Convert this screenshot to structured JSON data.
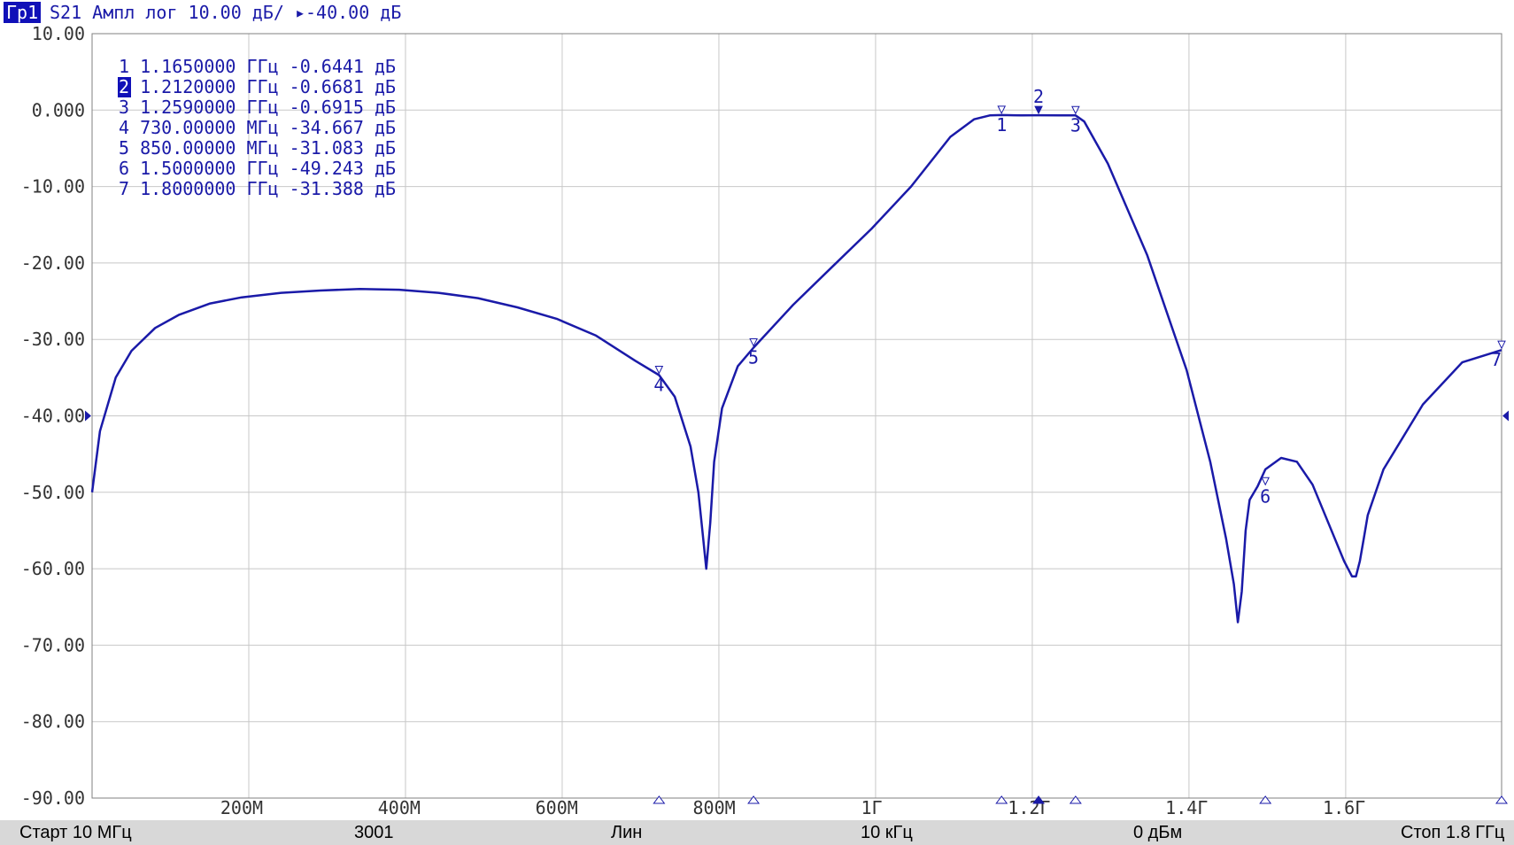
{
  "header": {
    "trace_tag": "Гр1",
    "trace_title": "S21 Ампл лог 10.00 дБ/ ▸-40.00 дБ"
  },
  "status": {
    "start": "Старт 10 МГц",
    "points": "3001",
    "sweep_type": "Лин",
    "ifbw": "10 кГц",
    "power": "0 дБм",
    "stop": "Стоп 1.8 ГГц"
  },
  "colors": {
    "trace": "#1a1aa8",
    "grid": "#c8c8c8",
    "active_marker_bg": "#1010b8"
  },
  "chart_data": {
    "type": "line",
    "title": "",
    "xlabel": "",
    "ylabel": "",
    "xlim": [
      0.01,
      1.8
    ],
    "ylim": [
      -90,
      10
    ],
    "reference_level": -40,
    "grid": true,
    "y_ticks": [
      {
        "value": 10,
        "label": "10.00"
      },
      {
        "value": 0,
        "label": "0.000"
      },
      {
        "value": -10,
        "label": "-10.00"
      },
      {
        "value": -20,
        "label": "-20.00"
      },
      {
        "value": -30,
        "label": "-30.00"
      },
      {
        "value": -40,
        "label": "-40.00"
      },
      {
        "value": -50,
        "label": "-50.00"
      },
      {
        "value": -60,
        "label": "-60.00"
      },
      {
        "value": -70,
        "label": "-70.00"
      },
      {
        "value": -80,
        "label": "-80.00"
      },
      {
        "value": -90,
        "label": "-90.00"
      }
    ],
    "x_ticks": [
      {
        "value": 0.2,
        "label": "200М"
      },
      {
        "value": 0.4,
        "label": "400М"
      },
      {
        "value": 0.6,
        "label": "600М"
      },
      {
        "value": 0.8,
        "label": "800М"
      },
      {
        "value": 1.0,
        "label": "1Г"
      },
      {
        "value": 1.2,
        "label": "1.2Г"
      },
      {
        "value": 1.4,
        "label": "1.4Г"
      },
      {
        "value": 1.6,
        "label": "1.6Г"
      }
    ],
    "x_grid": [
      0.01,
      0.209,
      0.408,
      0.607,
      0.806,
      1.005,
      1.204,
      1.403,
      1.602,
      1.8
    ],
    "series": [
      {
        "x": [
          0.01,
          0.02,
          0.04,
          0.06,
          0.09,
          0.12,
          0.16,
          0.2,
          0.25,
          0.3,
          0.35,
          0.4,
          0.45,
          0.5,
          0.55,
          0.6,
          0.65,
          0.7,
          0.73,
          0.75,
          0.77,
          0.78,
          0.785,
          0.79,
          0.795,
          0.8,
          0.81,
          0.83,
          0.85,
          0.9,
          0.95,
          1.0,
          1.05,
          1.1,
          1.13,
          1.15,
          1.165,
          1.19,
          1.212,
          1.24,
          1.259,
          1.27,
          1.3,
          1.35,
          1.4,
          1.43,
          1.45,
          1.46,
          1.465,
          1.47,
          1.475,
          1.48,
          1.49,
          1.5,
          1.52,
          1.54,
          1.56,
          1.58,
          1.6,
          1.61,
          1.615,
          1.62,
          1.625,
          1.63,
          1.65,
          1.7,
          1.75,
          1.8
        ],
        "y": [
          -50.0,
          -42.0,
          -35.0,
          -31.5,
          -28.5,
          -26.8,
          -25.3,
          -24.5,
          -23.9,
          -23.6,
          -23.4,
          -23.5,
          -23.9,
          -24.6,
          -25.8,
          -27.3,
          -29.5,
          -32.8,
          -34.667,
          -37.5,
          -44.0,
          -50.0,
          -55.0,
          -60.0,
          -54.0,
          -46.0,
          -39.0,
          -33.5,
          -31.083,
          -25.5,
          -20.5,
          -15.5,
          -10.0,
          -3.5,
          -1.2,
          -0.7,
          -0.6441,
          -0.7,
          -0.6681,
          -0.7,
          -0.6915,
          -1.5,
          -7.0,
          -19.0,
          -34.0,
          -46.0,
          -56.0,
          -62.0,
          -67.0,
          -63.0,
          -55.0,
          -51.0,
          -49.243,
          -47.0,
          -45.5,
          -46.0,
          -49.0,
          -54.0,
          -59.0,
          -61.0,
          -61.0,
          -59.0,
          -56.0,
          -53.0,
          -47.0,
          -38.5,
          -33.0,
          -31.388
        ]
      }
    ],
    "markers": [
      {
        "id": "1",
        "x": 1.165,
        "y": -0.6441,
        "readout": "1 1.1650000 ГГц -0.6441 дБ",
        "active": false,
        "label_side": "below"
      },
      {
        "id": "2",
        "x": 1.212,
        "y": -0.6681,
        "readout": "2 1.2120000 ГГц -0.6681 дБ",
        "active": true,
        "label_side": "above"
      },
      {
        "id": "3",
        "x": 1.259,
        "y": -0.6915,
        "readout": "3 1.2590000 ГГц -0.6915 дБ",
        "active": false,
        "label_side": "below"
      },
      {
        "id": "4",
        "x": 0.73,
        "y": -34.667,
        "readout": "4 730.00000 МГц -34.667 дБ",
        "active": false,
        "label_side": "below"
      },
      {
        "id": "5",
        "x": 0.85,
        "y": -31.083,
        "readout": "5 850.00000 МГц -31.083 дБ",
        "active": false,
        "label_side": "below"
      },
      {
        "id": "6",
        "x": 1.5,
        "y": -49.243,
        "readout": "6 1.5000000 ГГц -49.243 дБ",
        "active": false,
        "label_side": "below"
      },
      {
        "id": "7",
        "x": 1.8,
        "y": -31.388,
        "readout": "7 1.8000000 ГГц -31.388 дБ",
        "active": false,
        "label_side": "below"
      }
    ]
  }
}
